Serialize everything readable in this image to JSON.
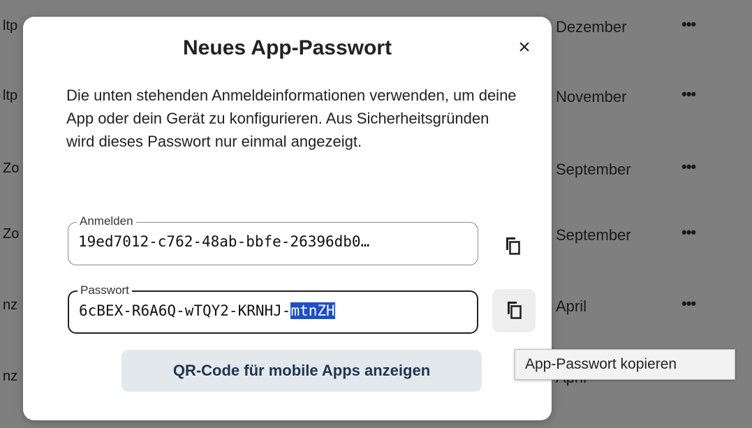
{
  "background_list": [
    {
      "left_fragment": "ltp",
      "month": "Dezember",
      "menu": "•••"
    },
    {
      "left_fragment": "ltp",
      "month": "November",
      "menu": "•••"
    },
    {
      "left_fragment": "Zo",
      "month": "September",
      "menu": "•••"
    },
    {
      "left_fragment": "Zo",
      "month": "September",
      "menu": "•••"
    },
    {
      "left_fragment": "nz",
      "month": "April",
      "menu": "•••"
    },
    {
      "left_fragment": "nz",
      "month": "April",
      "menu": ""
    }
  ],
  "dialog": {
    "title": "Neues App-Passwort",
    "close_icon": "×",
    "description": "Die unten stehenden Anmeldeinformationen verwenden, um deine App oder dein Gerät zu konfigurieren. Aus Sicherheitsgründen wird dieses Passwort nur einmal angezeigt.",
    "login_field": {
      "label": "Anmelden",
      "value": "19ed7012-c762-48ab-bbfe-26396db0…"
    },
    "password_field": {
      "label": "Passwort",
      "value_plain": "6cBEX-R6A6Q-wTQY2-KRNHJ-",
      "value_selected": "mtnZH"
    },
    "copy_icon": "copy-icon",
    "qr_button": "QR-Code für mobile Apps anzeigen"
  },
  "tooltip": "App-Passwort kopieren",
  "colors": {
    "backdrop": "#7f7f7f",
    "selection": "#1f4fc4",
    "qr_button_bg": "#e3e8ed",
    "qr_button_text": "#1f3550"
  }
}
